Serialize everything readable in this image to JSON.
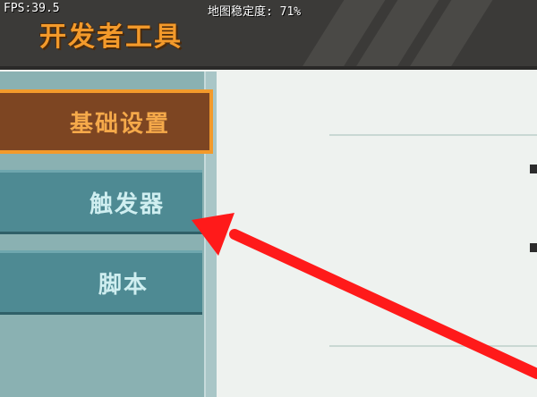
{
  "status": {
    "fps": "FPS:39.5",
    "map_stability": "地图稳定度: 71%"
  },
  "header": {
    "title": "开发者工具"
  },
  "sidebar": {
    "items": [
      {
        "label": "基础设置",
        "active": true
      },
      {
        "label": "触发器",
        "active": false
      },
      {
        "label": "脚本",
        "active": false
      }
    ]
  },
  "colors": {
    "accent": "#f39a2b",
    "active_bg": "#7d4522",
    "item_bg": "#4e8a93",
    "sidebar_bg": "#8ab1b2",
    "annotation": "#ff1a1a"
  },
  "annotation": {
    "icon": "red-arrow-icon"
  }
}
